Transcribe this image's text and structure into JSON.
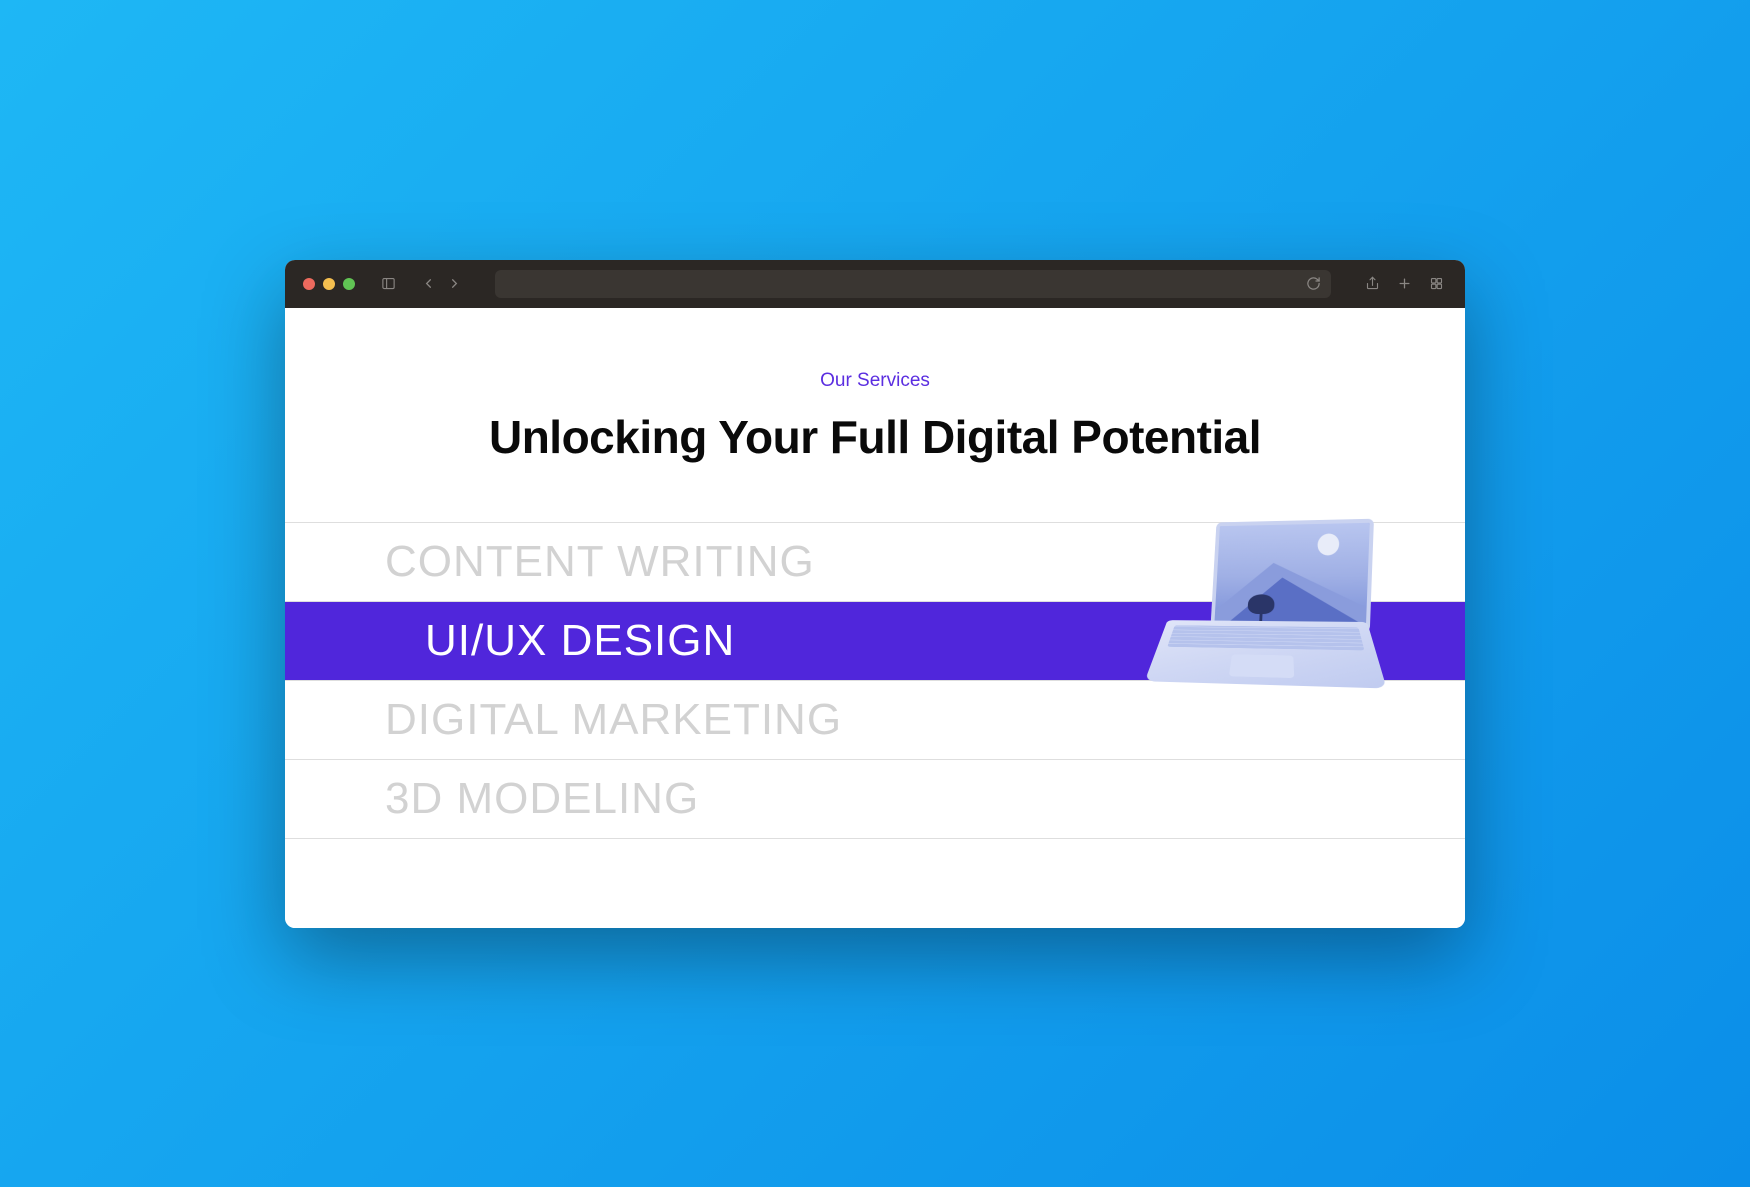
{
  "header": {
    "eyebrow": "Our Services",
    "title": "Unlocking Your Full Digital Potential"
  },
  "services": [
    {
      "label": "CONTENT WRITING",
      "active": false
    },
    {
      "label": "UI/UX DESIGN",
      "active": true
    },
    {
      "label": "DIGITAL MARKETING",
      "active": false
    },
    {
      "label": "3D MODELING",
      "active": false
    }
  ],
  "colors": {
    "accent": "#5026db",
    "eyebrow": "#5b2ee0"
  }
}
